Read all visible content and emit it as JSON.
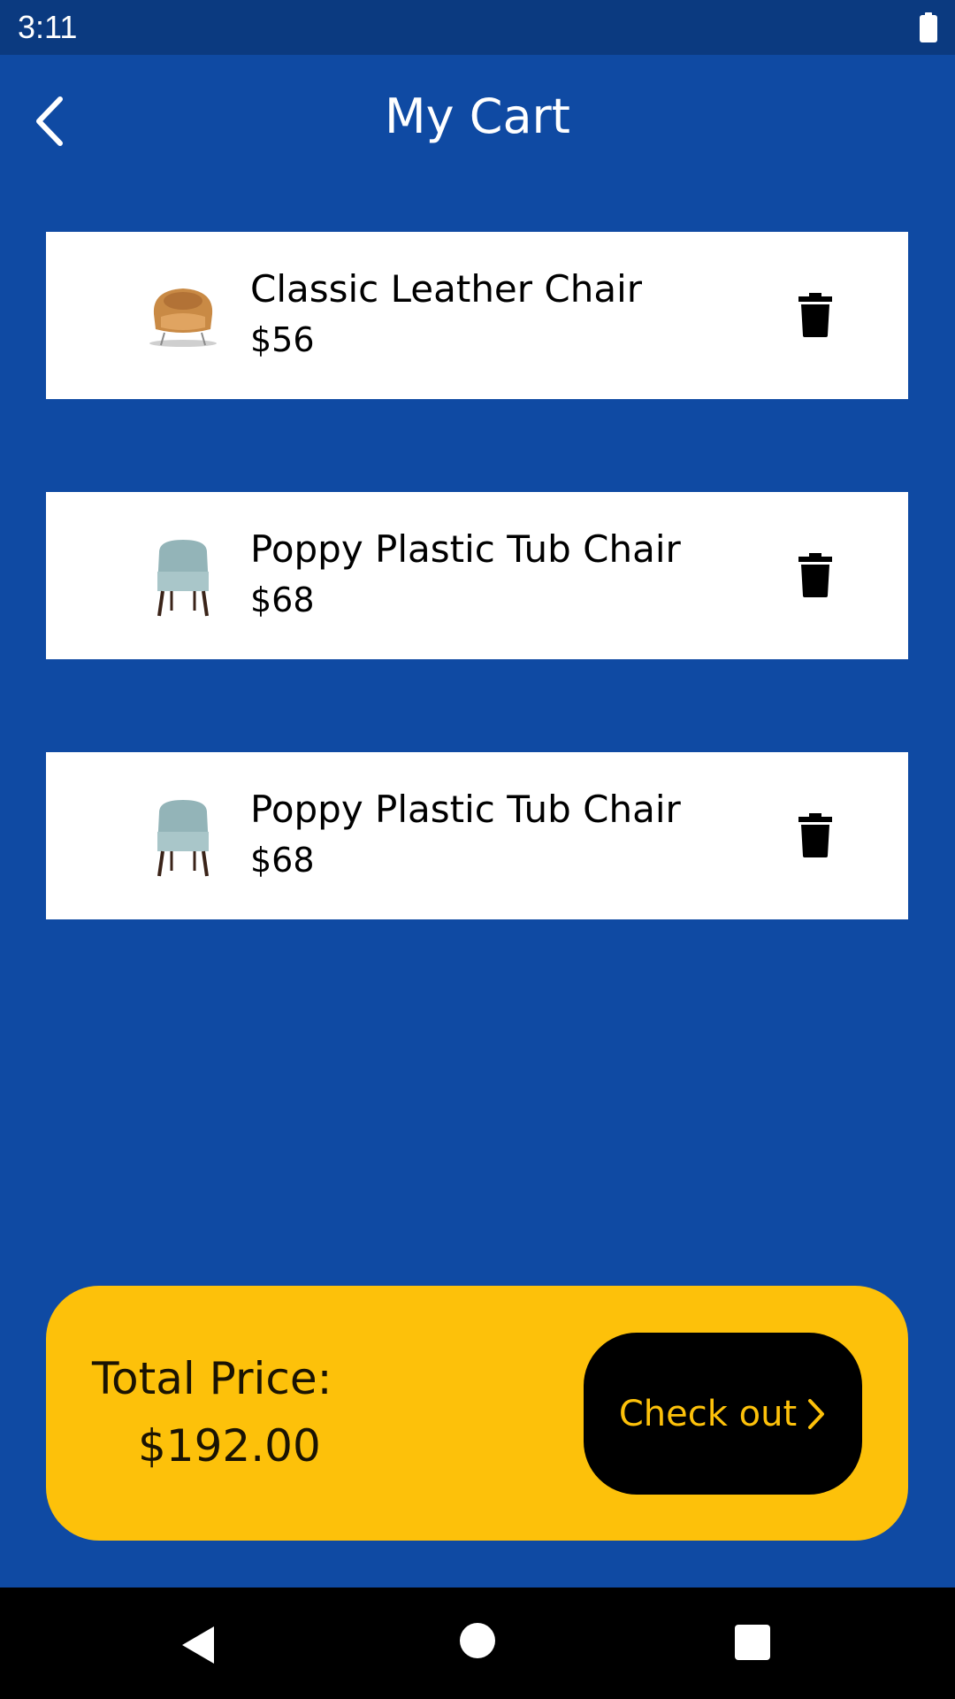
{
  "status_bar": {
    "time": "3:11"
  },
  "header": {
    "title": "My Cart",
    "back_icon": "chevron-left-icon"
  },
  "cart": {
    "items": [
      {
        "name": "Classic Leather Chair",
        "price": "$56",
        "image": "leather-armchair"
      },
      {
        "name": "Poppy Plastic Tub Chair",
        "price": "$68",
        "image": "tub-chair"
      },
      {
        "name": "Poppy Plastic Tub Chair",
        "price": "$68",
        "image": "tub-chair"
      }
    ]
  },
  "summary": {
    "total_label": "Total Price:",
    "total_value": "$192.00",
    "checkout_label": "Check out"
  },
  "colors": {
    "background": "#0f4aa3",
    "status_bar": "#0b3a80",
    "accent": "#fdc10a",
    "card": "#ffffff"
  }
}
